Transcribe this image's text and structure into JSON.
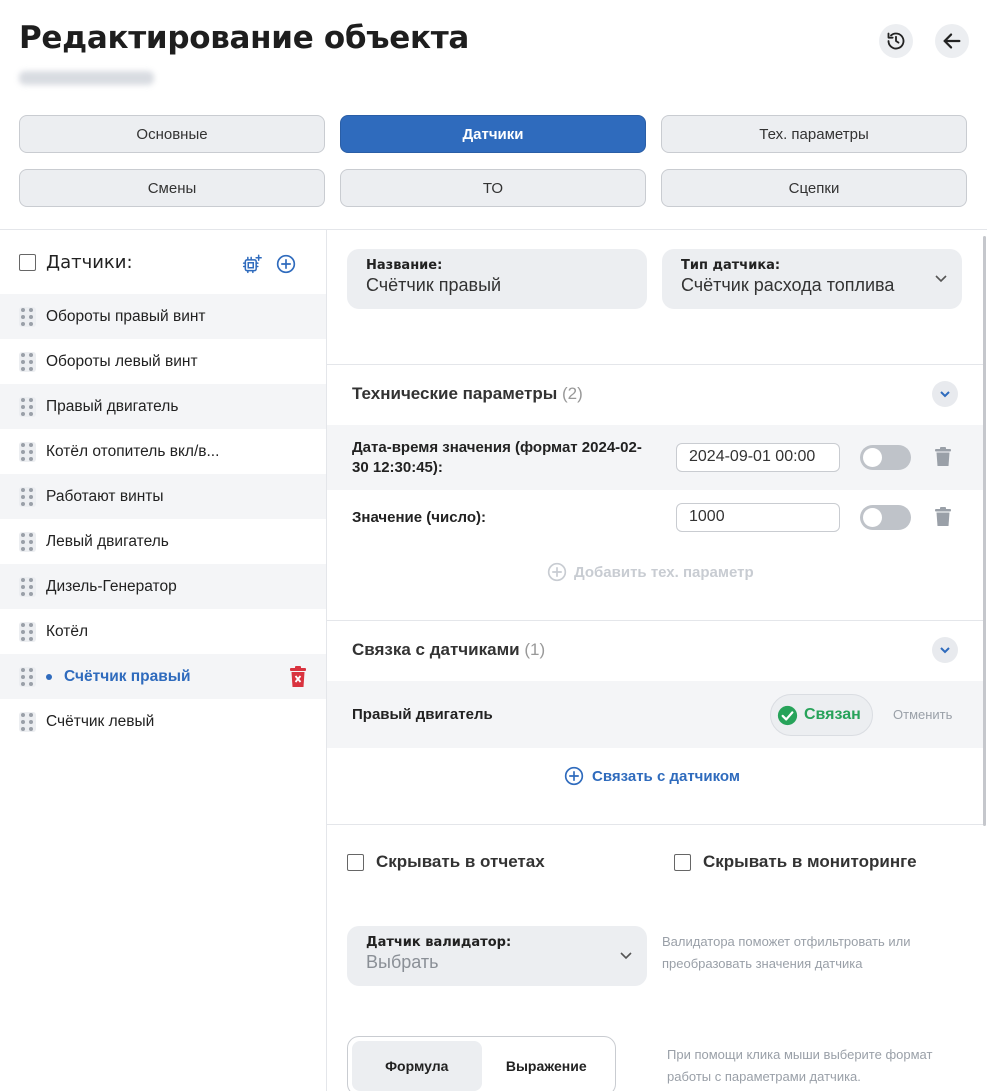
{
  "header": {
    "title": "Редактирование объекта"
  },
  "tabs": [
    {
      "label": "Основные",
      "active": false
    },
    {
      "label": "Датчики",
      "active": true
    },
    {
      "label": "Тех. параметры",
      "active": false
    },
    {
      "label": "Смены",
      "active": false
    },
    {
      "label": "ТО",
      "active": false
    },
    {
      "label": "Сцепки",
      "active": false
    }
  ],
  "sidebar": {
    "title": "Датчики:",
    "items": [
      {
        "label": "Обороты правый винт"
      },
      {
        "label": "Обороты левый винт"
      },
      {
        "label": "Правый двигатель"
      },
      {
        "label": "Котёл отопитель вкл/в..."
      },
      {
        "label": "Работают винты"
      },
      {
        "label": "Левый двигатель"
      },
      {
        "label": "Дизель-Генератор"
      },
      {
        "label": "Котёл"
      },
      {
        "label": "Счётчик правый",
        "active": true
      },
      {
        "label": "Счётчик левый"
      }
    ]
  },
  "form": {
    "name_label": "Название:",
    "name_value": "Счётчик правый",
    "type_label": "Тип датчика:",
    "type_value": "Счётчик расхода топлива"
  },
  "tech_params": {
    "title": "Технические параметры",
    "count": "(2)",
    "rows": [
      {
        "label_line1": "Дата-время значения (формат 2024-02-",
        "label_line2": "30 12:30:45):",
        "value": "2024-09-01 00:00"
      },
      {
        "label_line1": "Значение (число):",
        "label_line2": "",
        "value": "1000"
      }
    ],
    "add_label": "Добавить тех. параметр"
  },
  "links": {
    "title": "Связка с датчиками",
    "count": "(1)",
    "row_label": "Правый двигатель",
    "status": "Связан",
    "cancel": "Отменить",
    "add_label": "Связать с датчиком"
  },
  "checkboxes": {
    "hide_reports": "Скрывать в отчетах",
    "hide_monitoring": "Скрывать в мониторинге"
  },
  "validator": {
    "label": "Датчик валидатор:",
    "placeholder": "Выбрать",
    "hint_line1": "Валидатора поможет отфильтровать или",
    "hint_line2": "преобразовать значения датчика"
  },
  "mode": {
    "formula": "Формула",
    "expression": "Выражение",
    "hint_line1": "При помощи клика мыши выберите формат",
    "hint_line2": "работы с параметрами датчика."
  },
  "colors": {
    "accent": "#2f6bbd",
    "success": "#27a35a",
    "danger": "#d9333f"
  },
  "icons": {
    "history": "history-icon",
    "back": "arrow-left-icon",
    "copy": "copy-sensor-icon",
    "add": "plus-circle-icon",
    "delete": "trash-icon"
  }
}
